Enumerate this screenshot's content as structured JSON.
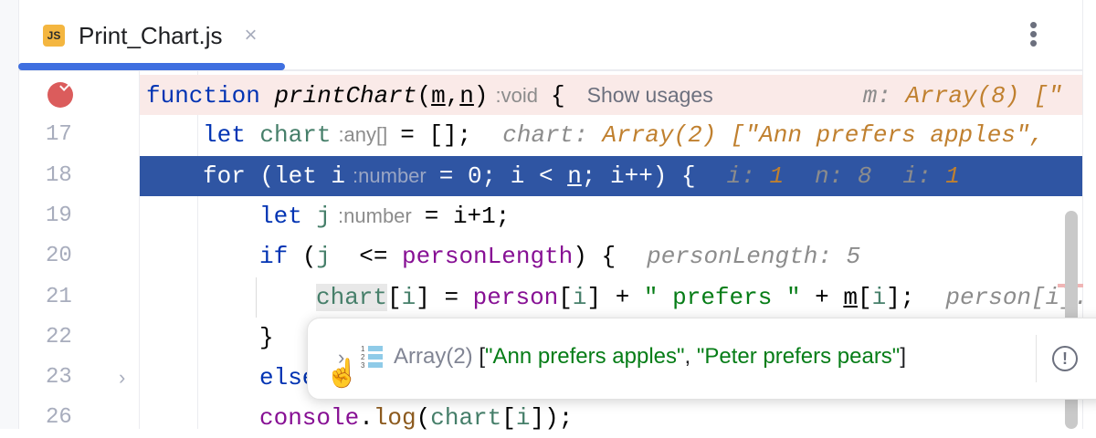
{
  "tab": {
    "icon_label": "JS",
    "filename": "Print_Chart.js",
    "close": "×"
  },
  "menu": {
    "more": "⋮"
  },
  "lines": [
    {
      "num": "",
      "kind": "bp",
      "indent": 0,
      "tokens": [
        {
          "t": "function ",
          "c": "kw"
        },
        {
          "t": "printChart",
          "c": "fn"
        },
        {
          "t": "(",
          "c": ""
        },
        {
          "t": "m",
          "c": "u"
        },
        {
          "t": ",",
          "c": ""
        },
        {
          "t": "n",
          "c": "u"
        },
        {
          "t": ")",
          "c": ""
        },
        {
          "t": ":void",
          "c": "hint"
        },
        {
          "t": "{",
          "c": ""
        },
        {
          "t": "Show usages",
          "c": "usages"
        },
        {
          "t": "m: ",
          "c": "dn"
        },
        {
          "t": "Array(8) [\"",
          "c": "dv"
        }
      ]
    },
    {
      "num": "17",
      "kind": "",
      "indent": 1,
      "tokens": [
        {
          "t": "let ",
          "c": "kw"
        },
        {
          "t": "chart",
          "c": "var"
        },
        {
          "t": ":any[]",
          "c": "hint"
        },
        {
          "t": "= [];",
          "c": ""
        },
        {
          "t": "chart: ",
          "c": "dn"
        },
        {
          "t": "Array(2) [\"Ann prefers apples\",",
          "c": "dv"
        }
      ]
    },
    {
      "num": "18",
      "kind": "cur",
      "indent": 1,
      "tokens": [
        {
          "t": "for (let i",
          "c": "kw"
        },
        {
          "t": ":number",
          "c": "hint"
        },
        {
          "t": "= 0; i < ",
          "c": ""
        },
        {
          "t": "n",
          "c": "u"
        },
        {
          "t": "; i++) {",
          "c": ""
        },
        {
          "t": "i: ",
          "c": "dn"
        },
        {
          "t": "1",
          "c": "dv"
        },
        {
          "t": "n: ",
          "c": "dn"
        },
        {
          "t": "8",
          "c": "dvg"
        },
        {
          "t": "i: ",
          "c": "dn"
        },
        {
          "t": "1",
          "c": "dv"
        }
      ]
    },
    {
      "num": "19",
      "kind": "",
      "indent": 2,
      "tokens": [
        {
          "t": "let ",
          "c": "kw"
        },
        {
          "t": "j",
          "c": "var"
        },
        {
          "t": ":number",
          "c": "hint"
        },
        {
          "t": "= i+1;",
          "c": ""
        }
      ]
    },
    {
      "num": "20",
      "kind": "",
      "indent": 2,
      "tokens": [
        {
          "t": "if ",
          "c": "kw"
        },
        {
          "t": "(",
          "c": ""
        },
        {
          "t": "j",
          "c": "var"
        },
        {
          "t": "  <= ",
          "c": ""
        },
        {
          "t": "personLength",
          "c": "pu"
        },
        {
          "t": ") {",
          "c": ""
        },
        {
          "t": "personLength: 5",
          "c": "dn"
        }
      ]
    },
    {
      "num": "21",
      "kind": "",
      "indent": 3,
      "tokens": [
        {
          "t": "chart",
          "c": "var hl"
        },
        {
          "t": "[",
          "c": ""
        },
        {
          "t": "i",
          "c": "var"
        },
        {
          "t": "] = ",
          "c": ""
        },
        {
          "t": "person",
          "c": "pu"
        },
        {
          "t": "[",
          "c": ""
        },
        {
          "t": "i",
          "c": "var"
        },
        {
          "t": "] + ",
          "c": ""
        },
        {
          "t": "\" prefers \"",
          "c": "str"
        },
        {
          "t": " + ",
          "c": ""
        },
        {
          "t": "m",
          "c": "u"
        },
        {
          "t": "[",
          "c": ""
        },
        {
          "t": "i",
          "c": "var"
        },
        {
          "t": "];",
          "c": ""
        },
        {
          "t": "person[i].",
          "c": "dn"
        }
      ]
    },
    {
      "num": "22",
      "kind": "",
      "indent": 2,
      "tokens": [
        {
          "t": "}",
          "c": ""
        }
      ]
    },
    {
      "num": "23",
      "kind": "",
      "indent": 2,
      "fold": "›",
      "tokens": [
        {
          "t": "else",
          "c": "kw"
        }
      ]
    },
    {
      "num": "26",
      "kind": "",
      "indent": 2,
      "tokens": [
        {
          "t": "console",
          "c": "pu"
        },
        {
          "t": ".",
          "c": ""
        },
        {
          "t": "log",
          "c": "brown"
        },
        {
          "t": "(",
          "c": ""
        },
        {
          "t": "chart",
          "c": "var"
        },
        {
          "t": "[",
          "c": ""
        },
        {
          "t": "i",
          "c": "var"
        },
        {
          "t": "]);",
          "c": ""
        }
      ]
    }
  ],
  "popup": {
    "expand": "›",
    "type": "Array(2)",
    "open": " [",
    "item1": "\"Ann prefers apples\"",
    "sep": ", ",
    "item2": "\"Peter prefers pears\"",
    "close": "]",
    "info": "!"
  }
}
